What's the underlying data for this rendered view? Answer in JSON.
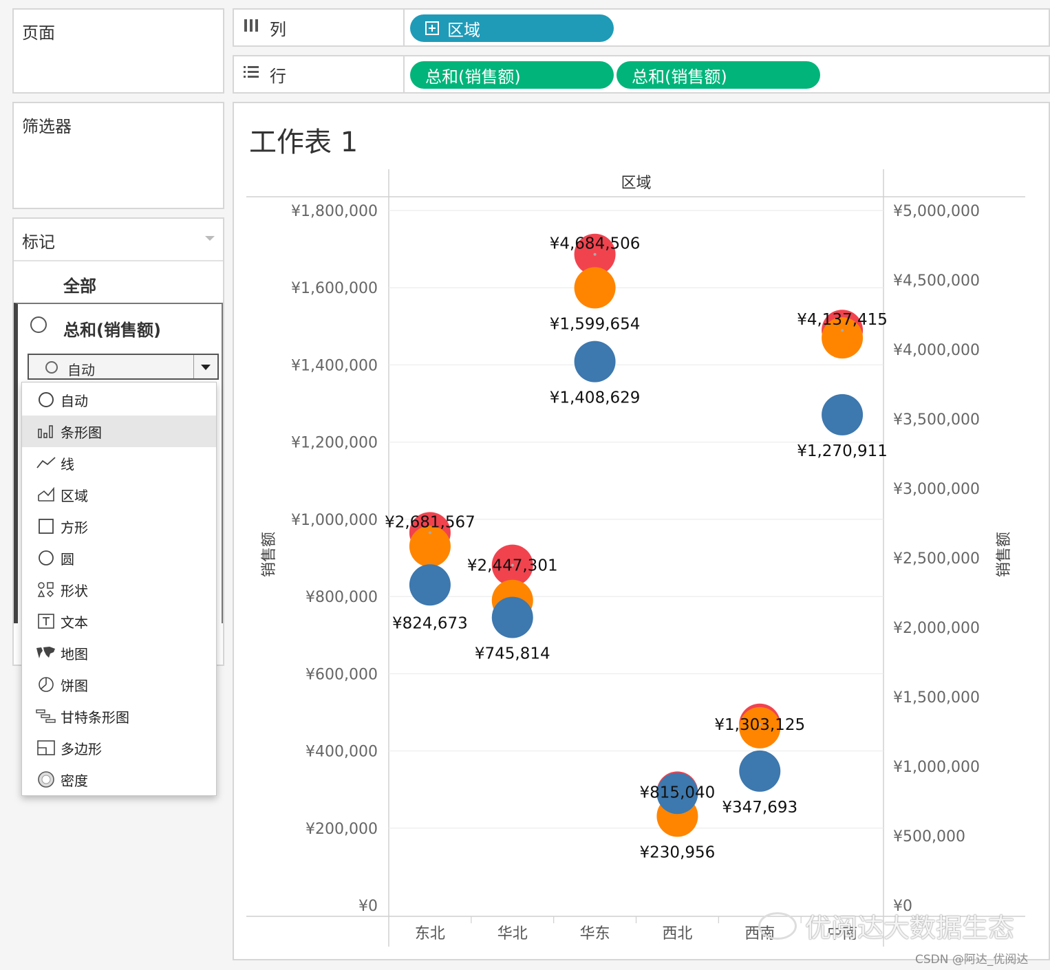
{
  "left_panels": {
    "pages_title": "页面",
    "filters_title": "筛选器",
    "marks_title": "标记",
    "marks_tab_all": "全部",
    "marks_tab_sum": "总和(销售额)",
    "mark_type_selected": "自动"
  },
  "mark_type_options": [
    {
      "label": "自动",
      "icon": "circle-outline-icon"
    },
    {
      "label": "条形图",
      "icon": "bar-chart-icon"
    },
    {
      "label": "线",
      "icon": "line-chart-icon"
    },
    {
      "label": "区域",
      "icon": "area-chart-icon"
    },
    {
      "label": "方形",
      "icon": "square-icon"
    },
    {
      "label": "圆",
      "icon": "circle-icon"
    },
    {
      "label": "形状",
      "icon": "shapes-icon"
    },
    {
      "label": "文本",
      "icon": "text-icon"
    },
    {
      "label": "地图",
      "icon": "map-icon"
    },
    {
      "label": "饼图",
      "icon": "pie-icon"
    },
    {
      "label": "甘特条形图",
      "icon": "gantt-icon"
    },
    {
      "label": "多边形",
      "icon": "polygon-icon"
    },
    {
      "label": "密度",
      "icon": "density-icon"
    }
  ],
  "highlighted_option": "条形图",
  "shelves": {
    "columns_label": "列",
    "rows_label": "行",
    "columns_pill": "区域",
    "rows_pills": [
      "总和(销售额)",
      "总和(销售额)"
    ]
  },
  "sheet": {
    "title": "工作表 1"
  },
  "chart_data": {
    "type": "scatter",
    "column_header": "区域",
    "categories": [
      "东北",
      "华北",
      "华东",
      "西北",
      "西南",
      "中南"
    ],
    "left_axis": {
      "label": "销售额",
      "ticks": [
        "¥0",
        "¥200,000",
        "¥400,000",
        "¥600,000",
        "¥800,000",
        "¥1,000,000",
        "¥1,200,000",
        "¥1,400,000",
        "¥1,600,000",
        "¥1,800,000"
      ],
      "range": [
        0,
        1800000
      ]
    },
    "right_axis": {
      "label": "销售额",
      "ticks": [
        "¥0",
        "¥500,000",
        "¥1,000,000",
        "¥1,500,000",
        "¥2,000,000",
        "¥2,500,000",
        "¥3,000,000",
        "¥3,500,000",
        "¥4,000,000",
        "¥4,500,000",
        "¥5,000,000"
      ],
      "range": [
        0,
        5000000
      ]
    },
    "colors": {
      "blue": "#3d78ae",
      "orange": "#ff8500",
      "red": "#f1434e"
    },
    "series": [
      {
        "color": "blue",
        "axis": "left",
        "values": [
          830000,
          745814,
          1408629,
          290000,
          347693,
          1270911
        ]
      },
      {
        "color": "orange",
        "axis": "left",
        "values": [
          930000,
          790000,
          1599654,
          230956,
          460000,
          1470000
        ]
      },
      {
        "color": "red",
        "axis": "right",
        "values": [
          2681567,
          2447301,
          4684506,
          815040,
          1303125,
          4137415
        ]
      }
    ],
    "labels": [
      {
        "text": "¥2,681,567",
        "category": "东北",
        "axis": "right",
        "value": 2681567,
        "pos": "above"
      },
      {
        "text": "¥824,673",
        "category": "东北",
        "axis": "left",
        "value": 824673,
        "pos": "below"
      },
      {
        "text": "¥2,447,301",
        "category": "华北",
        "axis": "right",
        "value": 2447301,
        "pos": "center"
      },
      {
        "text": "¥745,814",
        "category": "华北",
        "axis": "left",
        "value": 745814,
        "pos": "below"
      },
      {
        "text": "¥4,684,506",
        "category": "华东",
        "axis": "right",
        "value": 4684506,
        "pos": "above"
      },
      {
        "text": "¥1,599,654",
        "category": "华东",
        "axis": "left",
        "value": 1599654,
        "pos": "below"
      },
      {
        "text": "¥1,408,629",
        "category": "华东",
        "axis": "left",
        "value": 1408629,
        "pos": "below"
      },
      {
        "text": "¥815,040",
        "category": "西北",
        "axis": "right",
        "value": 815040,
        "pos": "center"
      },
      {
        "text": "¥230,956",
        "category": "西北",
        "axis": "left",
        "value": 230956,
        "pos": "below"
      },
      {
        "text": "¥1,303,125",
        "category": "西南",
        "axis": "right",
        "value": 1303125,
        "pos": "center"
      },
      {
        "text": "¥347,693",
        "category": "西南",
        "axis": "left",
        "value": 347693,
        "pos": "below"
      },
      {
        "text": "¥4,137,415",
        "category": "中南",
        "axis": "right",
        "value": 4137415,
        "pos": "above"
      },
      {
        "text": "¥1,270,911",
        "category": "中南",
        "axis": "left",
        "value": 1270911,
        "pos": "below"
      }
    ]
  },
  "watermark": {
    "text": "优阅达大数据生态",
    "credit": "CSDN @阿达_优阅达"
  }
}
